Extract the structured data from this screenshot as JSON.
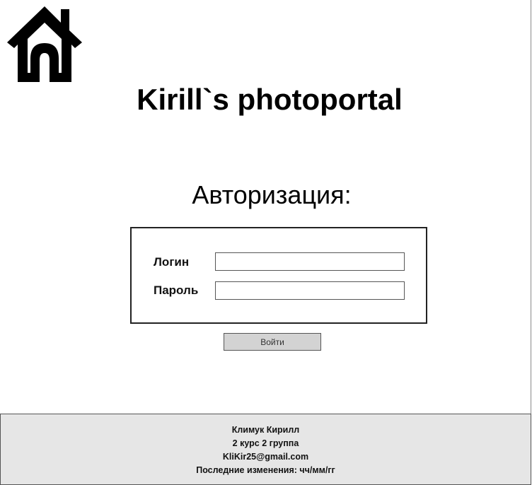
{
  "header": {
    "home_icon": "home-icon",
    "site_title": "Kirill`s photoportal"
  },
  "auth": {
    "heading": "Авторизация:",
    "login_label": "Логин",
    "login_value": "",
    "password_label": "Пароль",
    "password_value": "",
    "submit_label": "Войти"
  },
  "footer": {
    "author": "Климук Кирилл",
    "group": "2 курс 2 группа",
    "email": "KliKir25@gmail.com",
    "last_modified": "Последние изменения: чч/мм/гг"
  }
}
